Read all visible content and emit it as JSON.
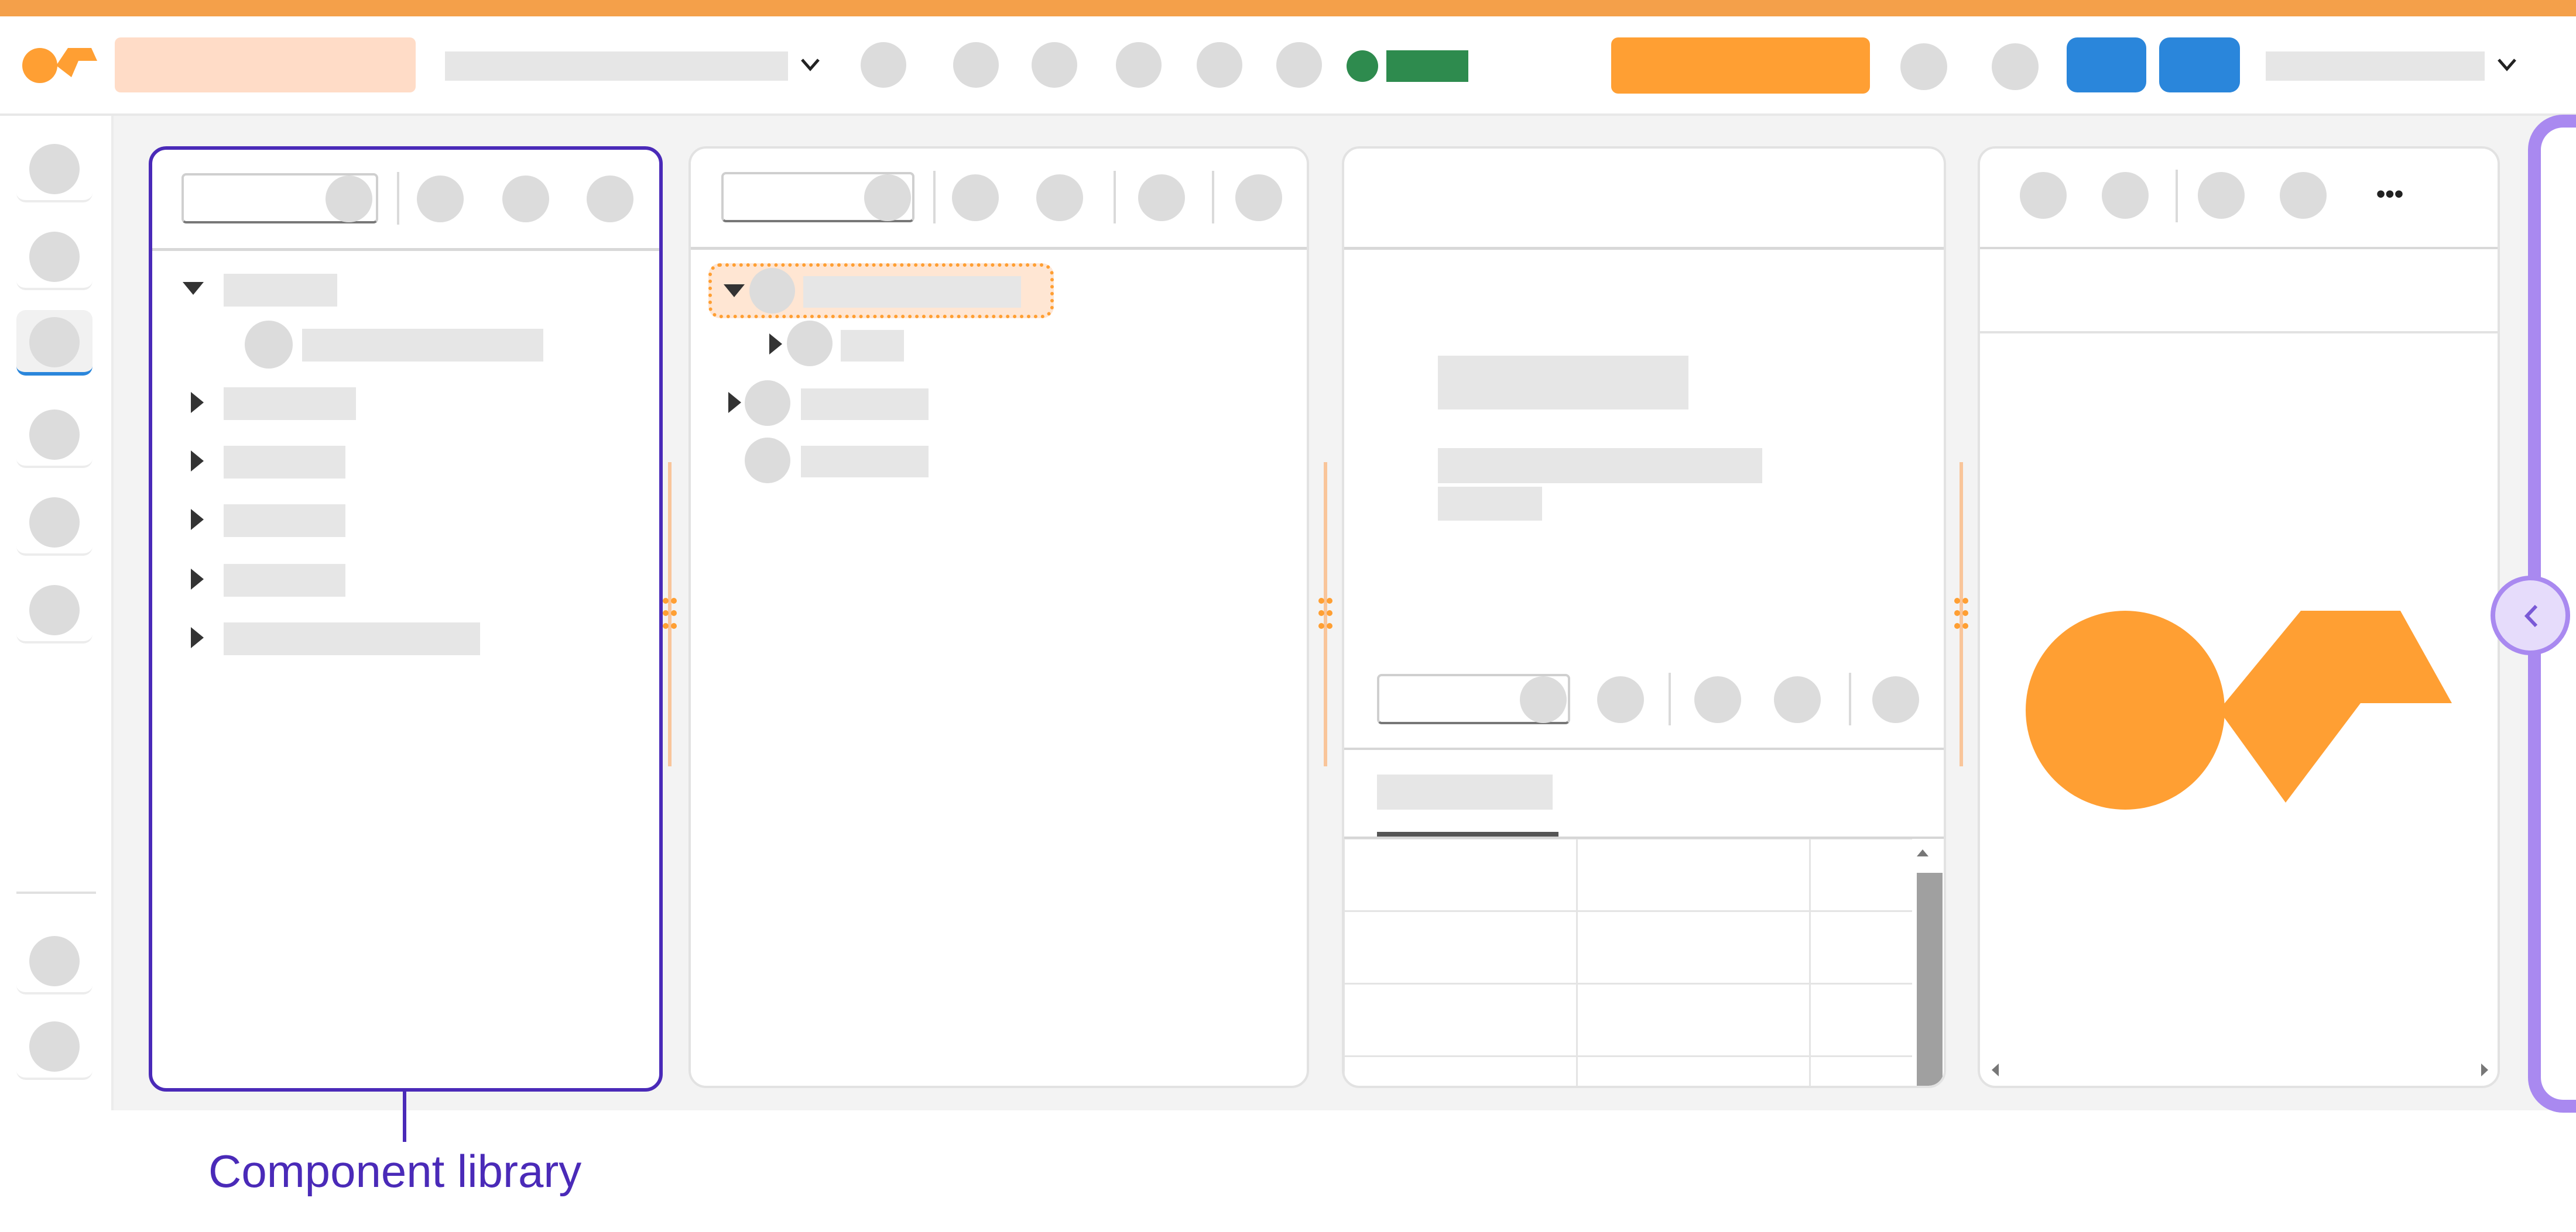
{
  "colors": {
    "accent_orange": "#ff9f33",
    "highlight_peach": "#ffdcc7",
    "primary_blue": "#2a86db",
    "status_green": "#2e8b4e",
    "annotation_purple": "#4a2ab8",
    "assistant_border_purple": "#a989f0",
    "assistant_handle_fill": "#e6dcfb",
    "placeholder_gray": "#e6e6e6",
    "icon_gray": "#dcdcdc"
  },
  "header": {
    "logo": "app-logo-icon",
    "project_dropdown_icon": "chevron-down-icon",
    "user_dropdown_icon": "chevron-down-icon"
  },
  "panels": {
    "preview": {
      "more_menu_glyph": "•••",
      "logo": "app-logo-icon"
    },
    "assistant": {
      "collapse_glyph": "‹"
    }
  },
  "annotation": {
    "label": "Component library"
  }
}
